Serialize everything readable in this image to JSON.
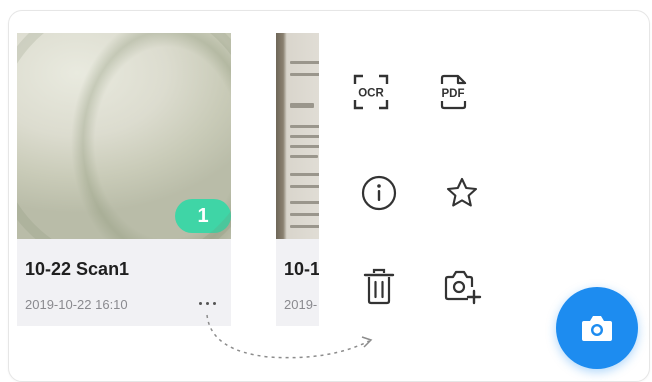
{
  "cards": [
    {
      "title": "10-22 Scan1",
      "date": "2019-10-22 16:10",
      "page_count": "1"
    },
    {
      "title": "10-1",
      "date": "2019-"
    }
  ],
  "actions": {
    "ocr_label": "OCR",
    "pdf_label": "PDF"
  },
  "colors": {
    "badge": "#3fd5a6",
    "fab": "#1d8cf0",
    "icon": "#333333"
  },
  "icons": [
    "ocr-icon",
    "pdf-icon",
    "info-icon",
    "star-icon",
    "trash-icon",
    "add-photo-icon",
    "more-icon",
    "camera-icon"
  ]
}
